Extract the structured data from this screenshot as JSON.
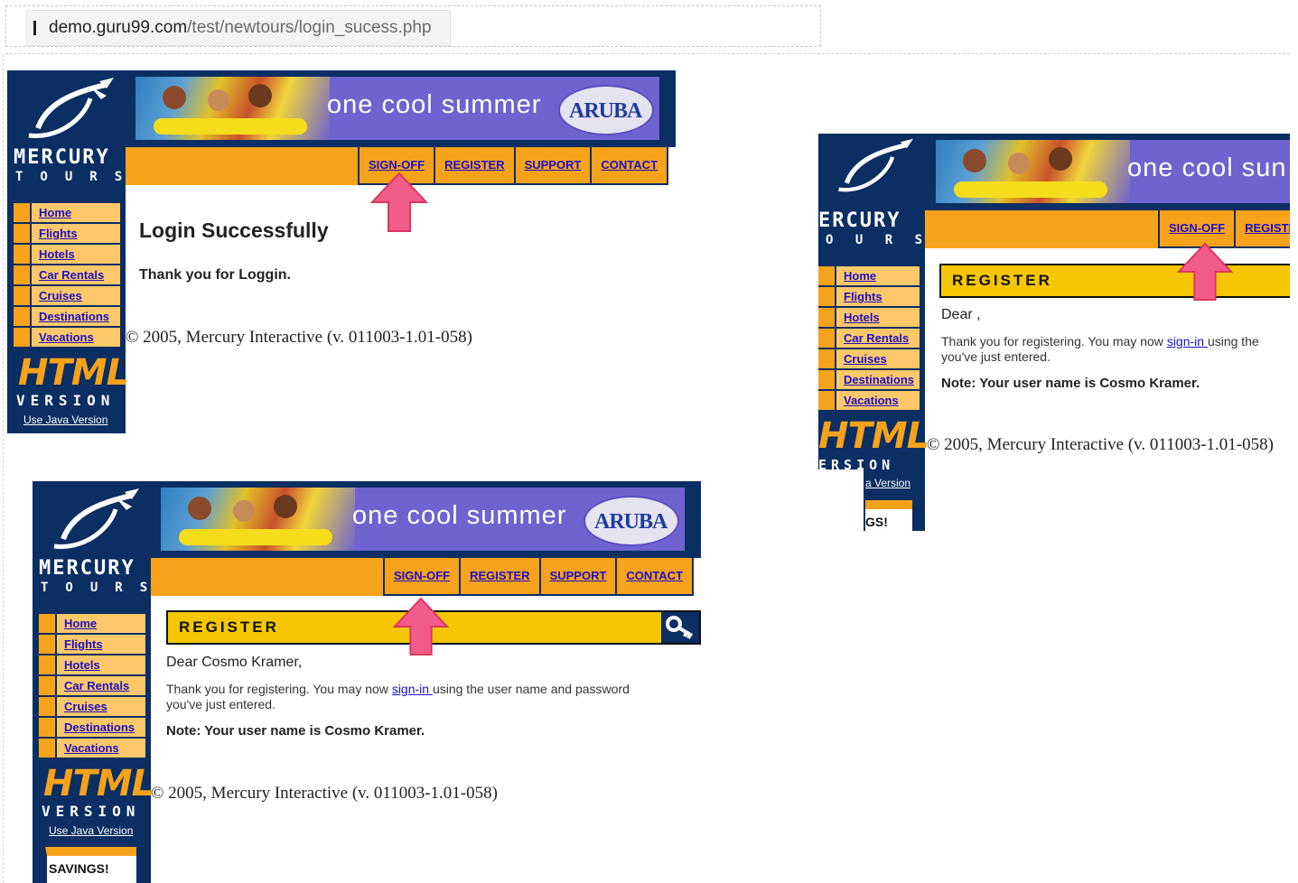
{
  "address_bar": {
    "host": "demo.guru99.com",
    "path": "/test/newtours/login_sucess.php"
  },
  "brand": {
    "name": "MERCURY",
    "subtitle": "TOURS",
    "banner_tagline": "one cool summer",
    "banner_logo": "ARUBA",
    "html_version": "HTML",
    "version_word": "VERSION",
    "java_link": "Use Java Version"
  },
  "top_nav": [
    "SIGN-OFF",
    "REGISTER",
    "SUPPORT",
    "CONTACT"
  ],
  "side_nav": [
    "Home",
    "Flights",
    "Hotels",
    "Car Rentals",
    "Cruises",
    "Destinations",
    "Vacations"
  ],
  "panel_login": {
    "heading": "Login Successfully",
    "message": "Thank you for Loggin.",
    "copyright": "© 2005, Mercury Interactive (v. 011003-1.01-058)"
  },
  "panel_register_full": {
    "bar_title": "REGISTER",
    "greeting": "Dear Cosmo  Kramer,",
    "thanks_before": "Thank you for registering. You may now ",
    "thanks_link": "sign-in ",
    "thanks_after": "using the user name and password",
    "thanks_line2": "you've just entered.",
    "note": "Note: Your user name is Cosmo Kramer.",
    "copyright": "© 2005, Mercury Interactive (v. 011003-1.01-058)",
    "savings": "SAVINGS!"
  },
  "panel_register_cropped": {
    "top_nav_visible": [
      "SIGN-OFF",
      "REGISTI"
    ],
    "brand_visible": "ERCURY",
    "subtitle_visible": "O U R S",
    "tagline_visible": "one cool sun",
    "bar_title": "REGISTER",
    "greeting": "Dear  ,",
    "thanks_before": "Thank you for registering. You may now ",
    "thanks_link": "sign-in ",
    "thanks_after": "using the",
    "thanks_line2": "you've just entered.",
    "note": "Note: Your user name is Cosmo Kramer.",
    "copyright": "© 2005, Mercury Interactive (v. 011003-1.01-058)",
    "version_visible": "ERSION",
    "java_visible": "a Version",
    "savings_visible": "GS!"
  },
  "colors": {
    "navy": "#0b2e63",
    "orange": "#f7a21b",
    "light_orange": "#fcc869",
    "banner_purple": "#6f63cf",
    "link_blue": "#1b10c8",
    "register_yellow": "#f6c700",
    "arrow_pink": "#f25c8a"
  }
}
